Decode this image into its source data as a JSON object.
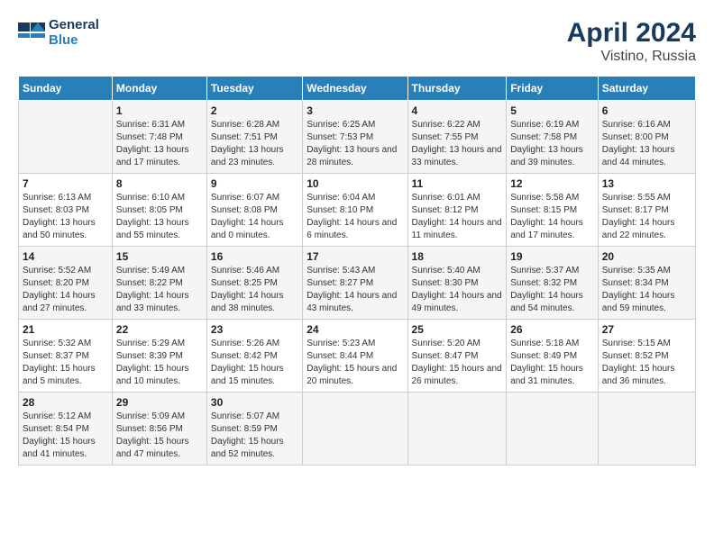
{
  "header": {
    "logo_general": "General",
    "logo_blue": "Blue",
    "title": "April 2024",
    "subtitle": "Vistino, Russia"
  },
  "columns": [
    "Sunday",
    "Monday",
    "Tuesday",
    "Wednesday",
    "Thursday",
    "Friday",
    "Saturday"
  ],
  "weeks": [
    [
      {
        "day": "",
        "sunrise": "",
        "sunset": "",
        "daylight": ""
      },
      {
        "day": "1",
        "sunrise": "Sunrise: 6:31 AM",
        "sunset": "Sunset: 7:48 PM",
        "daylight": "Daylight: 13 hours and 17 minutes."
      },
      {
        "day": "2",
        "sunrise": "Sunrise: 6:28 AM",
        "sunset": "Sunset: 7:51 PM",
        "daylight": "Daylight: 13 hours and 23 minutes."
      },
      {
        "day": "3",
        "sunrise": "Sunrise: 6:25 AM",
        "sunset": "Sunset: 7:53 PM",
        "daylight": "Daylight: 13 hours and 28 minutes."
      },
      {
        "day": "4",
        "sunrise": "Sunrise: 6:22 AM",
        "sunset": "Sunset: 7:55 PM",
        "daylight": "Daylight: 13 hours and 33 minutes."
      },
      {
        "day": "5",
        "sunrise": "Sunrise: 6:19 AM",
        "sunset": "Sunset: 7:58 PM",
        "daylight": "Daylight: 13 hours and 39 minutes."
      },
      {
        "day": "6",
        "sunrise": "Sunrise: 6:16 AM",
        "sunset": "Sunset: 8:00 PM",
        "daylight": "Daylight: 13 hours and 44 minutes."
      }
    ],
    [
      {
        "day": "7",
        "sunrise": "Sunrise: 6:13 AM",
        "sunset": "Sunset: 8:03 PM",
        "daylight": "Daylight: 13 hours and 50 minutes."
      },
      {
        "day": "8",
        "sunrise": "Sunrise: 6:10 AM",
        "sunset": "Sunset: 8:05 PM",
        "daylight": "Daylight: 13 hours and 55 minutes."
      },
      {
        "day": "9",
        "sunrise": "Sunrise: 6:07 AM",
        "sunset": "Sunset: 8:08 PM",
        "daylight": "Daylight: 14 hours and 0 minutes."
      },
      {
        "day": "10",
        "sunrise": "Sunrise: 6:04 AM",
        "sunset": "Sunset: 8:10 PM",
        "daylight": "Daylight: 14 hours and 6 minutes."
      },
      {
        "day": "11",
        "sunrise": "Sunrise: 6:01 AM",
        "sunset": "Sunset: 8:12 PM",
        "daylight": "Daylight: 14 hours and 11 minutes."
      },
      {
        "day": "12",
        "sunrise": "Sunrise: 5:58 AM",
        "sunset": "Sunset: 8:15 PM",
        "daylight": "Daylight: 14 hours and 17 minutes."
      },
      {
        "day": "13",
        "sunrise": "Sunrise: 5:55 AM",
        "sunset": "Sunset: 8:17 PM",
        "daylight": "Daylight: 14 hours and 22 minutes."
      }
    ],
    [
      {
        "day": "14",
        "sunrise": "Sunrise: 5:52 AM",
        "sunset": "Sunset: 8:20 PM",
        "daylight": "Daylight: 14 hours and 27 minutes."
      },
      {
        "day": "15",
        "sunrise": "Sunrise: 5:49 AM",
        "sunset": "Sunset: 8:22 PM",
        "daylight": "Daylight: 14 hours and 33 minutes."
      },
      {
        "day": "16",
        "sunrise": "Sunrise: 5:46 AM",
        "sunset": "Sunset: 8:25 PM",
        "daylight": "Daylight: 14 hours and 38 minutes."
      },
      {
        "day": "17",
        "sunrise": "Sunrise: 5:43 AM",
        "sunset": "Sunset: 8:27 PM",
        "daylight": "Daylight: 14 hours and 43 minutes."
      },
      {
        "day": "18",
        "sunrise": "Sunrise: 5:40 AM",
        "sunset": "Sunset: 8:30 PM",
        "daylight": "Daylight: 14 hours and 49 minutes."
      },
      {
        "day": "19",
        "sunrise": "Sunrise: 5:37 AM",
        "sunset": "Sunset: 8:32 PM",
        "daylight": "Daylight: 14 hours and 54 minutes."
      },
      {
        "day": "20",
        "sunrise": "Sunrise: 5:35 AM",
        "sunset": "Sunset: 8:34 PM",
        "daylight": "Daylight: 14 hours and 59 minutes."
      }
    ],
    [
      {
        "day": "21",
        "sunrise": "Sunrise: 5:32 AM",
        "sunset": "Sunset: 8:37 PM",
        "daylight": "Daylight: 15 hours and 5 minutes."
      },
      {
        "day": "22",
        "sunrise": "Sunrise: 5:29 AM",
        "sunset": "Sunset: 8:39 PM",
        "daylight": "Daylight: 15 hours and 10 minutes."
      },
      {
        "day": "23",
        "sunrise": "Sunrise: 5:26 AM",
        "sunset": "Sunset: 8:42 PM",
        "daylight": "Daylight: 15 hours and 15 minutes."
      },
      {
        "day": "24",
        "sunrise": "Sunrise: 5:23 AM",
        "sunset": "Sunset: 8:44 PM",
        "daylight": "Daylight: 15 hours and 20 minutes."
      },
      {
        "day": "25",
        "sunrise": "Sunrise: 5:20 AM",
        "sunset": "Sunset: 8:47 PM",
        "daylight": "Daylight: 15 hours and 26 minutes."
      },
      {
        "day": "26",
        "sunrise": "Sunrise: 5:18 AM",
        "sunset": "Sunset: 8:49 PM",
        "daylight": "Daylight: 15 hours and 31 minutes."
      },
      {
        "day": "27",
        "sunrise": "Sunrise: 5:15 AM",
        "sunset": "Sunset: 8:52 PM",
        "daylight": "Daylight: 15 hours and 36 minutes."
      }
    ],
    [
      {
        "day": "28",
        "sunrise": "Sunrise: 5:12 AM",
        "sunset": "Sunset: 8:54 PM",
        "daylight": "Daylight: 15 hours and 41 minutes."
      },
      {
        "day": "29",
        "sunrise": "Sunrise: 5:09 AM",
        "sunset": "Sunset: 8:56 PM",
        "daylight": "Daylight: 15 hours and 47 minutes."
      },
      {
        "day": "30",
        "sunrise": "Sunrise: 5:07 AM",
        "sunset": "Sunset: 8:59 PM",
        "daylight": "Daylight: 15 hours and 52 minutes."
      },
      {
        "day": "",
        "sunrise": "",
        "sunset": "",
        "daylight": ""
      },
      {
        "day": "",
        "sunrise": "",
        "sunset": "",
        "daylight": ""
      },
      {
        "day": "",
        "sunrise": "",
        "sunset": "",
        "daylight": ""
      },
      {
        "day": "",
        "sunrise": "",
        "sunset": "",
        "daylight": ""
      }
    ]
  ]
}
